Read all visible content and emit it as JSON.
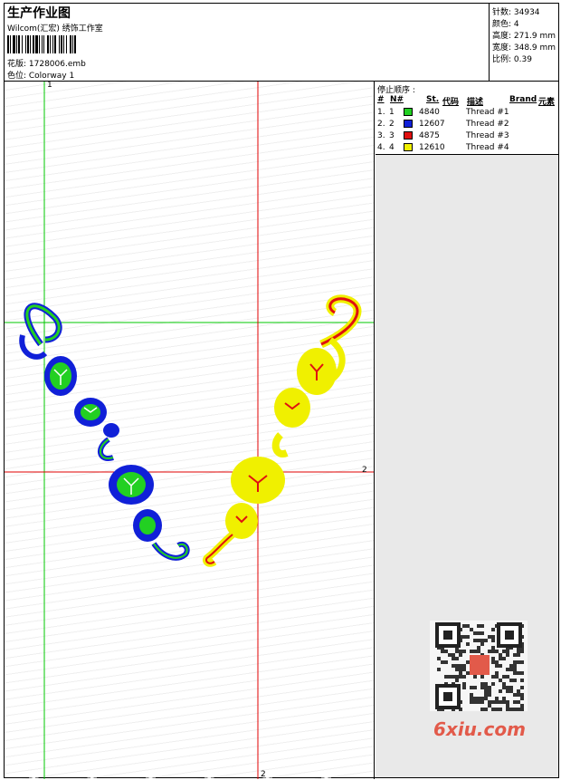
{
  "header": {
    "title": "生产作业图",
    "designer": "Wilcom(汇宏) 绣饰工作室",
    "design_file": "花版:  1728006.emb",
    "colorway": "色位:  Colorway 1"
  },
  "stats": {
    "stitches": "针数: 34934",
    "colors": "颜色: 4",
    "height": "高度: 271.9 mm",
    "width": "宽度: 348.9 mm",
    "scale": "比例: 0.39"
  },
  "stop_sequence": {
    "title": "停止顺序 :",
    "columns": {
      "hash": "#",
      "n": "N#",
      "st": "St.",
      "code": "代码",
      "desc": "描述",
      "brand": "Brand",
      "element": "元素"
    },
    "rows": [
      {
        "idx": "1.",
        "n": "1",
        "color": "#22d022",
        "code": "4840",
        "desc": "Thread #1"
      },
      {
        "idx": "2.",
        "n": "2",
        "color": "#1020d8",
        "code": "12607",
        "desc": "Thread #2"
      },
      {
        "idx": "3.",
        "n": "3",
        "color": "#e01010",
        "code": "4875",
        "desc": "Thread #3"
      },
      {
        "idx": "4.",
        "n": "4",
        "color": "#f0f000",
        "code": "12610",
        "desc": "Thread #4"
      }
    ]
  },
  "axes": {
    "green_top": "1",
    "red_right": "2",
    "red_bottom": "2"
  },
  "colors": {
    "green_line": "#00c800",
    "red_line": "#e00000"
  },
  "watermark": "6xiu.com"
}
